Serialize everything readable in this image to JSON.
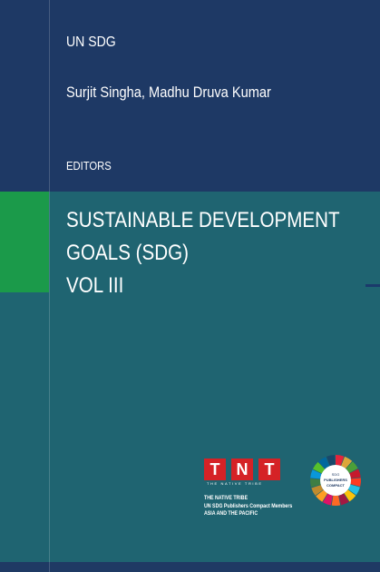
{
  "cover": {
    "series": "UN SDG",
    "authors": "Surjit Singha, Madhu Druva Kumar",
    "role": "EDITORS",
    "title_lines": [
      "SUSTAINABLE DEVELOPMENT",
      "GOALS (SDG)",
      "VOL III"
    ]
  },
  "publisher": {
    "logo_letters": [
      "T",
      "N",
      "T"
    ],
    "logo_tagline": "THE NATIVE TRIBE",
    "lines": [
      "THE NATIVE TRIBE",
      "UN SDG Publishers Compact Members",
      "ASIA AND THE PACIFIC"
    ]
  },
  "badge": {
    "lines": [
      "SDG",
      "PUBLISHERS",
      "COMPACT"
    ]
  },
  "colors": {
    "top_band": "#1e3965",
    "main_band": "#1f6471",
    "accent_green": "#1b9a4a",
    "logo_red": "#d52226"
  }
}
